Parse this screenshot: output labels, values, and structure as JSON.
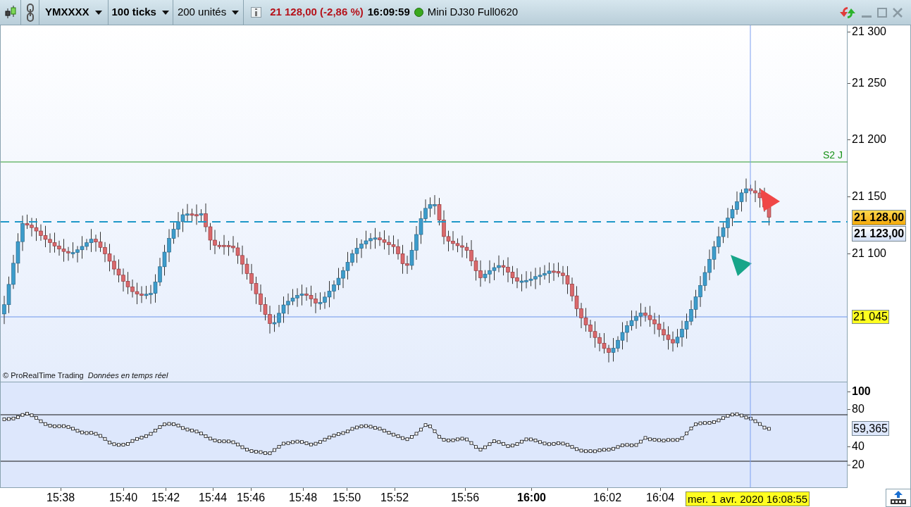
{
  "toolbar": {
    "instrument": "YMXXXX",
    "interval": "100 ticks",
    "units": "200 unités",
    "price_change": "21 128,00 (-2,86 %)",
    "time": "16:09:59",
    "market": "Mini DJ30 Full0620"
  },
  "main_chart": {
    "copyright": "© ProRealTime Trading",
    "realtime_note": "Données en temps réel",
    "line_label": "S2 J",
    "price_axis": [
      "21 300",
      "21 250",
      "21 200",
      "21 150",
      "21 100"
    ],
    "last_price": "21 128,00",
    "cursor_price": "21 123,00",
    "level_price": "21 045"
  },
  "indicator": {
    "axis": [
      {
        "label": "100",
        "bold": true
      },
      {
        "label": "80",
        "bold": false
      },
      {
        "label": "40",
        "bold": false
      },
      {
        "label": "20",
        "bold": false
      }
    ],
    "reading": "59,365"
  },
  "time_axis": [
    {
      "label": "15:38",
      "bold": false
    },
    {
      "label": "15:40",
      "bold": false
    },
    {
      "label": "15:42",
      "bold": false
    },
    {
      "label": "15:44",
      "bold": false
    },
    {
      "label": "15:46",
      "bold": false
    },
    {
      "label": "15:48",
      "bold": false
    },
    {
      "label": "15:50",
      "bold": false
    },
    {
      "label": "15:52",
      "bold": false
    },
    {
      "label": "15:56",
      "bold": false
    },
    {
      "label": "16:00",
      "bold": true
    },
    {
      "label": "16:02",
      "bold": false
    },
    {
      "label": "16:04",
      "bold": false
    }
  ],
  "cursor_date": "mer. 1 avr. 2020 16:08:55"
}
